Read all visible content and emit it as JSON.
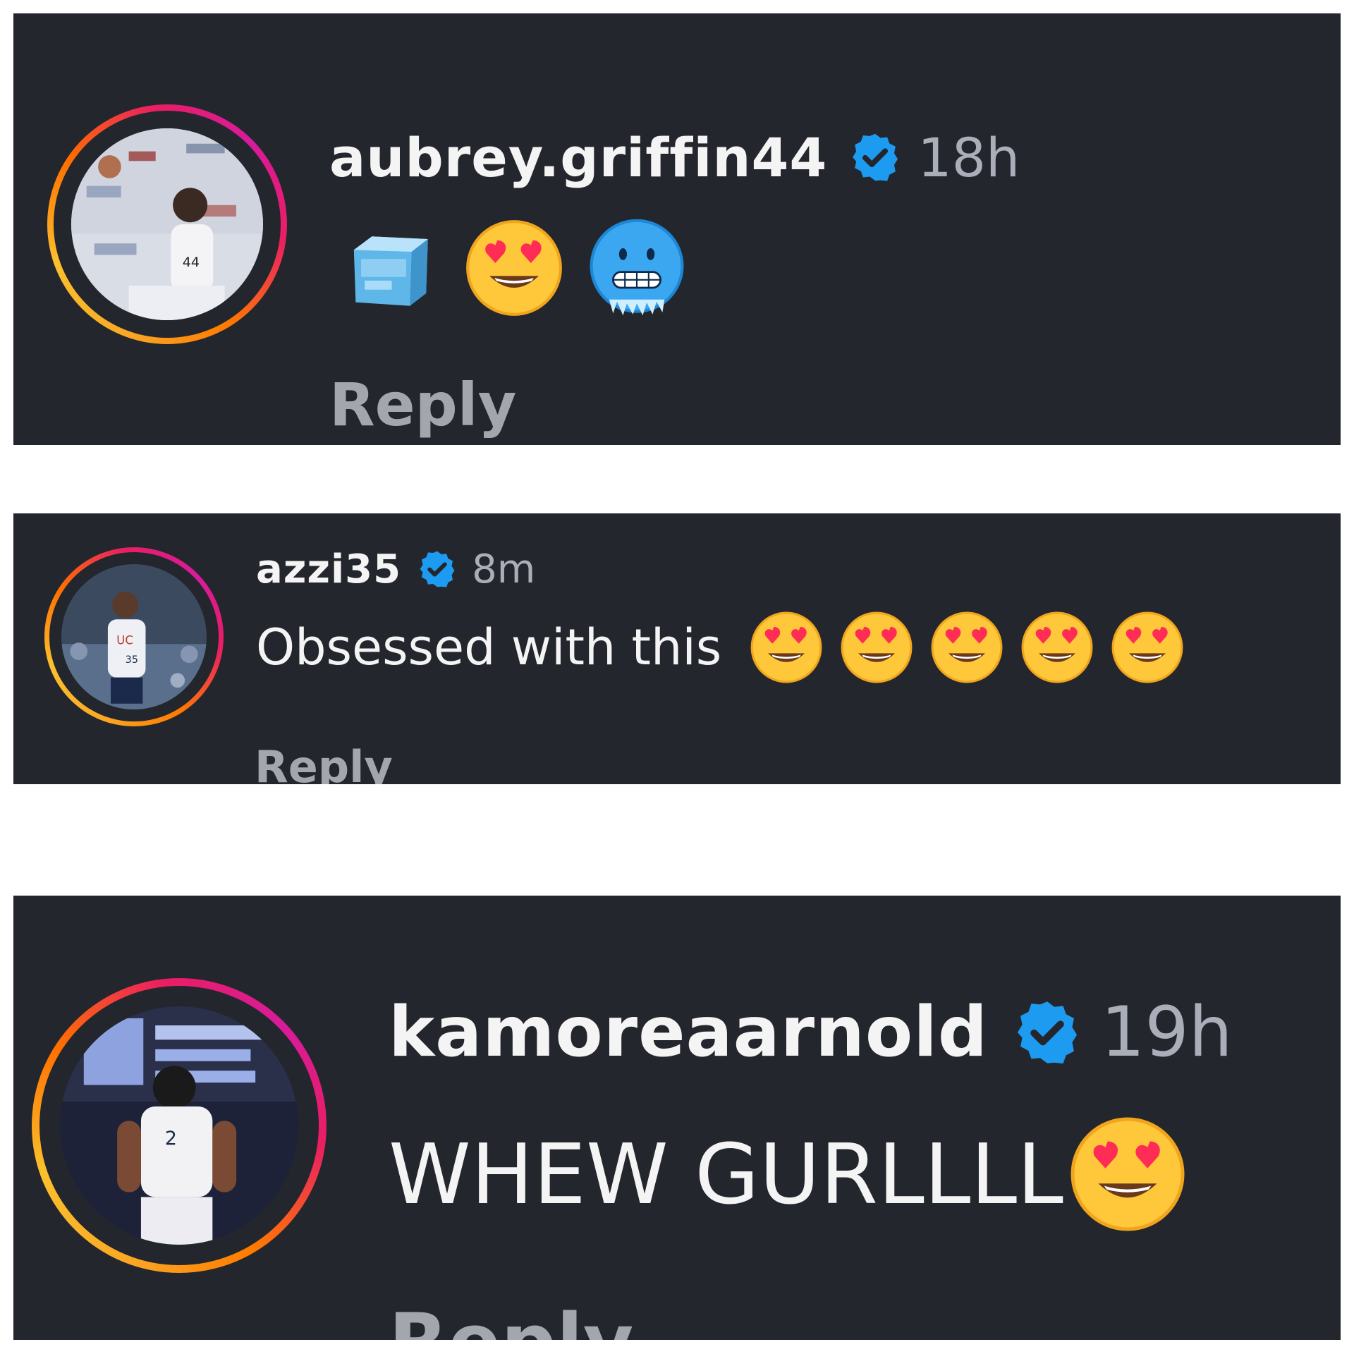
{
  "comments": [
    {
      "username": "aubrey.griffin44",
      "time": "18h",
      "text": "",
      "emojis": [
        "ice-cube-emoji",
        "heart-eyes-emoji",
        "cold-face-emoji"
      ],
      "reply_label": "Reply",
      "verified": true
    },
    {
      "username": "azzi35",
      "time": "8m",
      "text": "Obsessed with this",
      "emojis": [
        "heart-eyes-emoji",
        "heart-eyes-emoji",
        "heart-eyes-emoji",
        "heart-eyes-emoji",
        "heart-eyes-emoji"
      ],
      "reply_label": "Reply",
      "verified": true
    },
    {
      "username": "kamoreaarnold",
      "time": "19h",
      "text": "WHEW GURLLLL",
      "emojis": [
        "heart-eyes-emoji"
      ],
      "reply_label": "Reply",
      "verified": true
    }
  ],
  "colors": {
    "card_background": "#24262d",
    "verified_badge": "#1d9bf0",
    "story_ring": [
      "#f9a825",
      "#e91e63",
      "#d81b9c"
    ],
    "timestamp": "#a9aeb8",
    "reply": "#a3a6ad"
  }
}
